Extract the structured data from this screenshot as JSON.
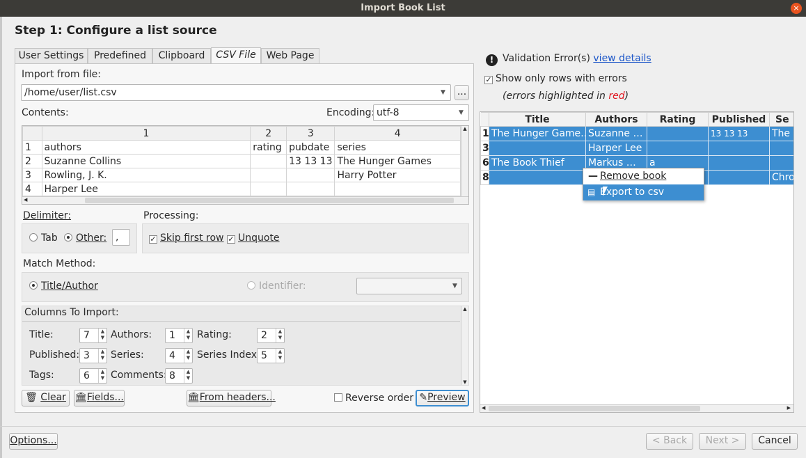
{
  "window": {
    "title": "Import Book List",
    "close_glyph": "×"
  },
  "step_title": "Step 1: Configure a list source",
  "tabs": [
    {
      "label": "User Settings"
    },
    {
      "label": "Predefined"
    },
    {
      "label": "Clipboard"
    },
    {
      "label": "CSV File",
      "active": true
    },
    {
      "label": "Web Page"
    }
  ],
  "csv": {
    "import_label": "Import from file:",
    "file_path": "/home/user/list.csv",
    "browse_label": "...",
    "contents_label": "Contents:",
    "encoding_label": "Encoding:",
    "encoding_value": "utf-8",
    "columns": [
      "1",
      "2",
      "3",
      "4"
    ],
    "rows": [
      {
        "n": "1",
        "c1": "authors",
        "c2": "rating",
        "c3": "pubdate",
        "c4": "series"
      },
      {
        "n": "2",
        "c1": "Suzanne Collins",
        "c2": "",
        "c3": "13 13 13",
        "c4": "The Hunger Games"
      },
      {
        "n": "3",
        "c1": "Rowling, J. K.",
        "c2": "",
        "c3": "",
        "c4": "Harry Potter"
      },
      {
        "n": "4",
        "c1": "Harper Lee",
        "c2": "",
        "c3": "",
        "c4": ""
      }
    ],
    "delimiter_label": "Delimiter:",
    "tab_label": "Tab",
    "other_label": "Other:",
    "other_value": ",",
    "processing_label": "Processing:",
    "skip_first_row_label": "Skip first row",
    "unquote_label": "Unquote",
    "match_method_label": "Match Method:",
    "title_author_label": "Title/Author",
    "identifier_label": "Identifier:",
    "columns_to_import_label": "Columns To Import:",
    "fields": {
      "title_label": "Title:",
      "title_value": "7",
      "authors_label": "Authors:",
      "authors_value": "1",
      "rating_label": "Rating:",
      "rating_value": "2",
      "published_label": "Published:",
      "published_value": "3",
      "series_label": "Series:",
      "series_value": "4",
      "series_index_label": "Series Index:",
      "series_index_value": "5",
      "tags_label": "Tags:",
      "tags_value": "6",
      "comments_label": "Comments:",
      "comments_value": "8"
    },
    "clear_label": "Clear",
    "fields_label": "Fields...",
    "from_headers_label": "From headers...",
    "reverse_order_label": "Reverse order",
    "preview_label": "Preview"
  },
  "validation": {
    "error_text": "Validation Error(s)",
    "view_details_link": "view details",
    "show_only_errors_label": "Show only rows with errors",
    "note_prefix": "(errors highlighted in ",
    "note_red": "red",
    "note_suffix": ")",
    "headers": [
      "Title",
      "Authors",
      "Rating",
      "Published",
      "Se"
    ],
    "rows": [
      {
        "n": "1",
        "title": "The Hunger Game…",
        "authors": "Suzanne …",
        "rating": "",
        "published": "13 13 13",
        "series": "The H"
      },
      {
        "n": "3",
        "title": "",
        "authors": "Harper Lee",
        "rating": "",
        "published": "",
        "series": ""
      },
      {
        "n": "6",
        "title": "The Book Thief",
        "authors": "Markus …",
        "rating": "a",
        "published": "",
        "series": ""
      },
      {
        "n": "8",
        "title": "",
        "authors": "",
        "rating": "",
        "published": "",
        "series": "Chro"
      }
    ]
  },
  "context_menu": {
    "remove_book": "Remove book",
    "export_csv": "Export to csv"
  },
  "footer": {
    "options": "Options...",
    "back": "< Back",
    "next": "Next >",
    "cancel": "Cancel"
  },
  "colors": {
    "selection": "#3d8ed1",
    "titlebar": "#3c3b37",
    "close": "#e95420",
    "error_red": "#e01b24",
    "link": "#1a55c8"
  }
}
